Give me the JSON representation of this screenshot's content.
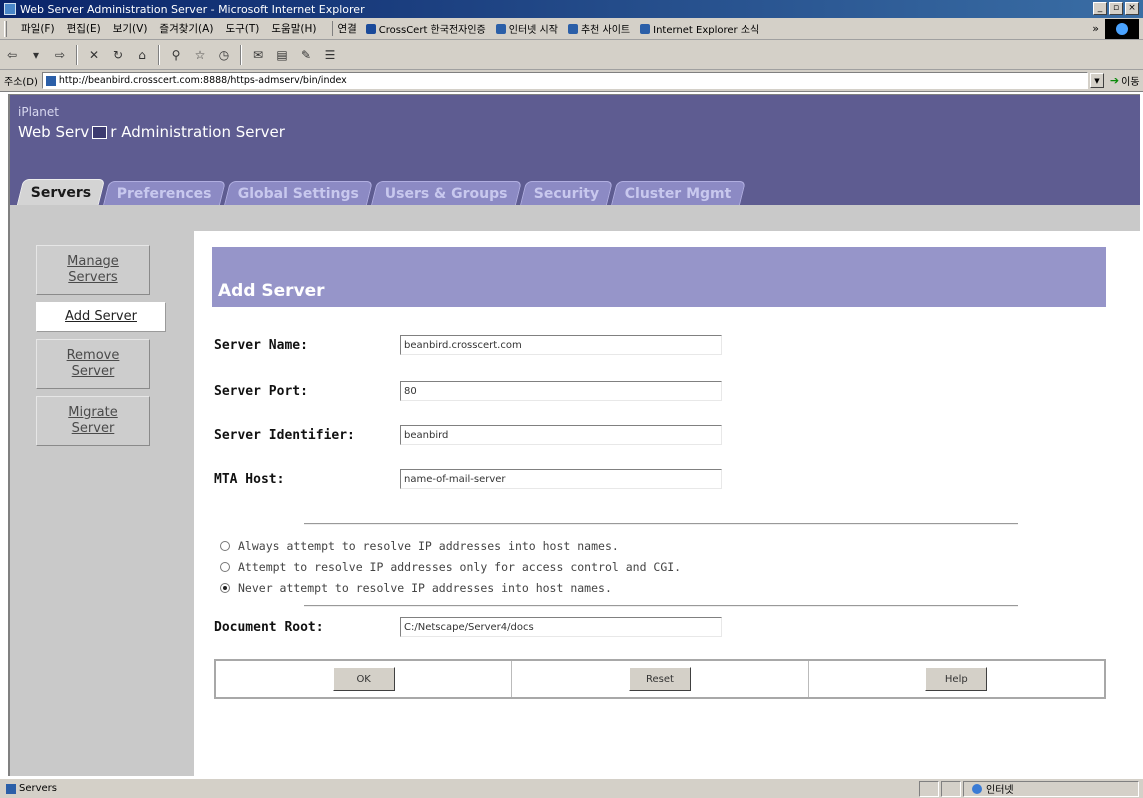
{
  "window": {
    "title": "Web Server Administration Server - Microsoft Internet Explorer",
    "controls": [
      "_",
      "▫",
      "×"
    ]
  },
  "menubar": {
    "items": [
      "파일(F)",
      "편집(E)",
      "보기(V)",
      "즐겨찾기(A)",
      "도구(T)",
      "도움말(H)"
    ],
    "links_label": "연결",
    "links": [
      "CrossCert 한국전자인증",
      "인터넷 시작",
      "추천 사이트",
      "Internet Explorer 소식"
    ]
  },
  "toolbar": {
    "icons": [
      "back-icon",
      "forward-icon",
      "stop-icon",
      "refresh-icon",
      "home-icon",
      "search-icon",
      "favorites-icon",
      "history-icon",
      "mail-icon",
      "print-icon",
      "edit-icon",
      "discuss-icon"
    ]
  },
  "address": {
    "label": "주소(D)",
    "url": "http://beanbird.crosscert.com:8888/https-admserv/bin/index",
    "go_label": "이동"
  },
  "banner": {
    "brand": "iPlanet",
    "product_prefix": "Web Serv",
    "product_suffix": "r Administration Server"
  },
  "tabs": [
    {
      "label": "Servers",
      "active": true
    },
    {
      "label": "Preferences",
      "active": false
    },
    {
      "label": "Global Settings",
      "active": false
    },
    {
      "label": "Users & Groups",
      "active": false
    },
    {
      "label": "Security",
      "active": false
    },
    {
      "label": "Cluster Mgmt",
      "active": false
    }
  ],
  "sidenav": [
    {
      "line1": "Manage",
      "line2": "Servers",
      "active": false
    },
    {
      "line1": "Add Server",
      "line2": "",
      "active": true
    },
    {
      "line1": "Remove",
      "line2": "Server",
      "active": false
    },
    {
      "line1": "Migrate",
      "line2": "Server",
      "active": false
    }
  ],
  "form": {
    "heading": "Add Server",
    "server_name_label": "Server Name:",
    "server_name_value": "beanbird.crosscert.com",
    "server_port_label": "Server Port:",
    "server_port_value": "80",
    "server_id_label": "Server Identifier:",
    "server_id_value": "beanbird",
    "mta_label": "MTA Host:",
    "mta_value": "name-of-mail-server",
    "radio_always": "Always attempt to resolve IP addresses into host names.",
    "radio_access": "Attempt to resolve IP addresses only for access control and CGI.",
    "radio_never": "Never attempt to resolve IP addresses into host names.",
    "selected_radio": "never",
    "docroot_label": "Document Root:",
    "docroot_value": "C:/Netscape/Server4/docs",
    "ok_label": "OK",
    "reset_label": "Reset",
    "help_label": "Help"
  },
  "status": {
    "text": "Servers",
    "zone": "인터넷"
  },
  "colors": {
    "banner": "#5e5c91",
    "section_head": "#9695c9",
    "chrome": "#d4d0c8"
  }
}
